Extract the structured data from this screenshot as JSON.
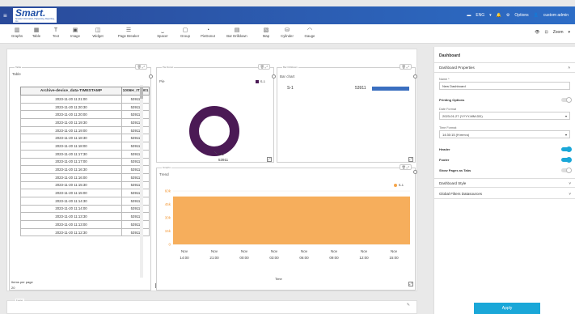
{
  "header": {
    "logo_text": "Smart.",
    "logo_tagline": "Smarter Information, Happening, Reporting, Inc.",
    "language": "ENG",
    "options_label": "Options",
    "user_label": "custom admin"
  },
  "toolbar": {
    "tools": [
      {
        "label": "Graphs",
        "icon": "bar-chart-icon"
      },
      {
        "label": "Table",
        "icon": "table-icon"
      },
      {
        "label": "Text",
        "icon": "text-icon"
      },
      {
        "label": "Image",
        "icon": "image-icon"
      },
      {
        "label": "Widget",
        "icon": "widget-icon"
      },
      {
        "label": "Page Breaker",
        "icon": "page-breaker-icon"
      },
      {
        "label": "Spacer",
        "icon": "spacer-icon"
      },
      {
        "label": "Group",
        "icon": "group-icon"
      },
      {
        "label": "PieDonut",
        "icon": "pie-icon"
      },
      {
        "label": "Bar Drilldown",
        "icon": "bar-drilldown-icon"
      },
      {
        "label": "Map",
        "icon": "map-icon"
      },
      {
        "label": "Cylinder",
        "icon": "cylinder-icon"
      },
      {
        "label": "Gauge",
        "icon": "gauge-icon"
      }
    ],
    "zoom_label": "Zoom"
  },
  "table_panel": {
    "tag": "Table",
    "title": "Table",
    "columns": [
      "Archive-device_data-TIMESTAMP",
      "1006H_IT_001"
    ],
    "rows": [
      [
        "2023-11-20 11:21:00",
        "53911"
      ],
      [
        "2023-11-20 11:20:30",
        "53911"
      ],
      [
        "2023-11-20 11:20:00",
        "53911"
      ],
      [
        "2023-11-20 11:19:30",
        "53911"
      ],
      [
        "2023-11-20 11:19:00",
        "53911"
      ],
      [
        "2023-11-20 11:18:30",
        "53911"
      ],
      [
        "2023-11-20 11:18:00",
        "53911"
      ],
      [
        "2023-11-20 11:17:30",
        "53911"
      ],
      [
        "2023-11-20 11:17:00",
        "53911"
      ],
      [
        "2023-11-20 11:16:30",
        "53911"
      ],
      [
        "2023-11-20 11:16:00",
        "53911"
      ],
      [
        "2023-11-20 11:15:30",
        "53911"
      ],
      [
        "2023-11-20 11:15:00",
        "53911"
      ],
      [
        "2023-11-20 11:14:30",
        "53911"
      ],
      [
        "2023-11-20 11:14:00",
        "53911"
      ],
      [
        "2023-11-20 11:13:30",
        "53911"
      ],
      [
        "2023-11-20 11:13:00",
        "53911"
      ],
      [
        "2023-11-20 11:12:30",
        "53911"
      ]
    ],
    "items_per_page_label": "Items per page",
    "items_per_page_value": "20"
  },
  "pie_panel": {
    "tag": "Pie Donut",
    "title": "Pie",
    "legend": "S-1",
    "slice_label": "S-1",
    "slice_value": "53911"
  },
  "bar_panel": {
    "tag": "Bar Drilldown",
    "title": "Bar chart",
    "row_label": "S-1",
    "row_value": "53911"
  },
  "trend_panel": {
    "tag": "Graphs",
    "title": "Trend",
    "legend": "S-1",
    "xlabel": "Time",
    "x_ticks": [
      [
        "Nov",
        "14:00"
      ],
      [
        "Nov",
        "21:00"
      ],
      [
        "Nov",
        "00:00"
      ],
      [
        "Nov",
        "03:00"
      ],
      [
        "Nov",
        "06:00"
      ],
      [
        "Nov",
        "09:00"
      ],
      [
        "Nov",
        "12:00"
      ],
      [
        "Nov",
        "15:00"
      ]
    ],
    "y_ticks": [
      "60k",
      "45k",
      "30k",
      "15k",
      "0"
    ]
  },
  "footer_panel": {
    "tag": "Footer"
  },
  "sidebar": {
    "title": "Dashboard",
    "properties_label": "Dashboard Properties",
    "name_label": "Name *",
    "name_value": "New Dashboard",
    "printing_label": "Printing Options",
    "date_format_label": "Date Format",
    "date_format_value": "2023-01-27 (YYYY-MM-DD)",
    "time_format_label": "Time Format",
    "time_format_value": "14:30:15 (H:mm:s)",
    "header_label": "Header",
    "footer_label": "Footer",
    "show_pages_label": "Show Pages as Tabs",
    "style_label": "Dashboard Style",
    "global_filters_label": "Global Filters Datasources",
    "apply_label": "Apply"
  },
  "chart_data": [
    {
      "type": "pie",
      "title": "Pie",
      "categories": [
        "S-1"
      ],
      "values": [
        53911
      ],
      "donut": true,
      "colors": [
        "#4b1a55"
      ]
    },
    {
      "type": "bar",
      "title": "Bar chart",
      "categories": [
        "S-1"
      ],
      "values": [
        53911
      ],
      "orientation": "horizontal",
      "colors": [
        "#3b6fc0"
      ]
    },
    {
      "type": "area",
      "title": "Trend",
      "xlabel": "Time",
      "categories": [
        "Nov 14:00",
        "Nov 21:00",
        "Nov 00:00",
        "Nov 03:00",
        "Nov 06:00",
        "Nov 09:00",
        "Nov 12:00",
        "Nov 15:00"
      ],
      "series": [
        {
          "name": "S-1",
          "values": [
            53911,
            53911,
            53911,
            53911,
            53911,
            53911,
            53911,
            53911
          ]
        }
      ],
      "ylim": [
        0,
        60000
      ],
      "colors": [
        "#f5a54a"
      ]
    }
  ]
}
